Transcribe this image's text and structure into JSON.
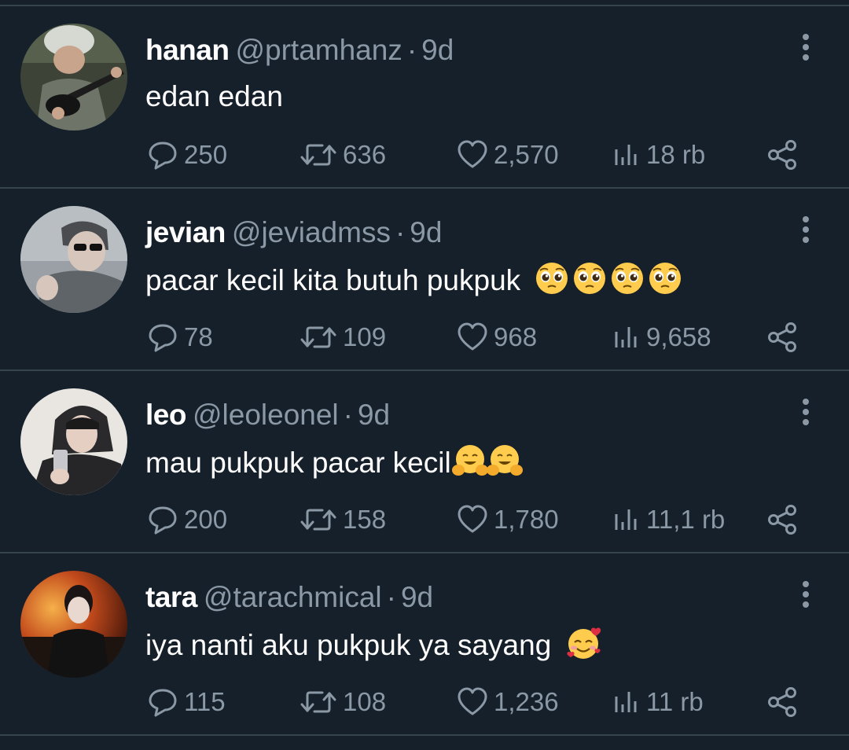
{
  "icons": {
    "reply": "speech-bubble-icon",
    "retweet": "retweet-arrows-icon",
    "like": "heart-icon",
    "views": "bar-chart-icon",
    "share": "share-nodes-icon",
    "more": "vertical-dots-icon"
  },
  "colors": {
    "background": "#15202b",
    "divider": "#38444d",
    "secondary_text": "#8b98a5",
    "primary_text": "#ffffff"
  },
  "tweets": [
    {
      "name": "hanan",
      "handle": "@prtamhanz",
      "separator": "·",
      "time": "9d",
      "text": "edan edan",
      "emojis": [],
      "replies": "250",
      "retweets": "636",
      "likes": "2,570",
      "views": "18 rb"
    },
    {
      "name": "jevian",
      "handle": "@jeviadmss",
      "separator": "·",
      "time": "9d",
      "text": "pacar kecil kita butuh pukpuk",
      "emojis": [
        "pleading-face",
        "pleading-face",
        "pleading-face",
        "pleading-face"
      ],
      "replies": "78",
      "retweets": "109",
      "likes": "968",
      "views": "9,658"
    },
    {
      "name": "leo",
      "handle": "@leoleonel",
      "separator": "·",
      "time": "9d",
      "text": "mau pukpuk pacar kecil",
      "emojis": [
        "hugging-face",
        "hugging-face"
      ],
      "replies": "200",
      "retweets": "158",
      "likes": "1,780",
      "views": "11,1 rb"
    },
    {
      "name": "tara",
      "handle": "@tarachmical",
      "separator": "·",
      "time": "9d",
      "text": "iya nanti aku pukpuk ya sayang",
      "emojis": [
        "smiling-face-with-hearts"
      ],
      "replies": "115",
      "retweets": "108",
      "likes": "1,236",
      "views": "11 rb"
    }
  ]
}
